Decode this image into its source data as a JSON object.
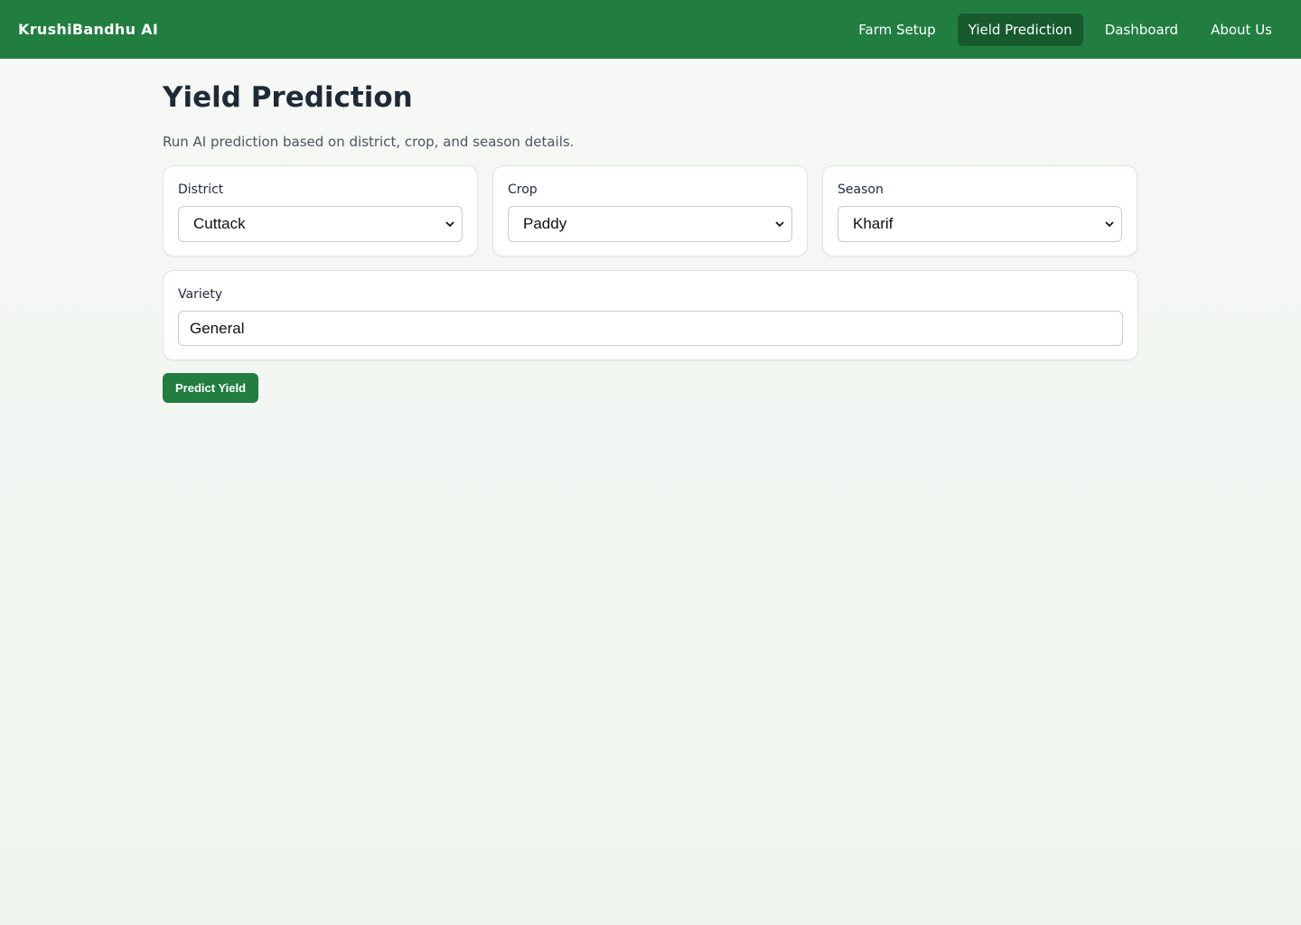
{
  "app": {
    "brand": "KrushiBandhu AI"
  },
  "nav": {
    "items": [
      {
        "label": "Farm Setup",
        "active": false
      },
      {
        "label": "Yield Prediction",
        "active": true
      },
      {
        "label": "Dashboard",
        "active": false
      },
      {
        "label": "About Us",
        "active": false
      }
    ]
  },
  "page": {
    "title": "Yield Prediction",
    "subtitle": "Run AI prediction based on district, crop, and season details."
  },
  "form": {
    "district": {
      "label": "District",
      "value": "Cuttack"
    },
    "crop": {
      "label": "Crop",
      "value": "Paddy"
    },
    "season": {
      "label": "Season",
      "value": "Kharif"
    },
    "variety": {
      "label": "Variety",
      "value": "General"
    },
    "submit_label": "Predict Yield"
  },
  "colors": {
    "primary": "#217e40",
    "nav_active": "#175a2e"
  }
}
